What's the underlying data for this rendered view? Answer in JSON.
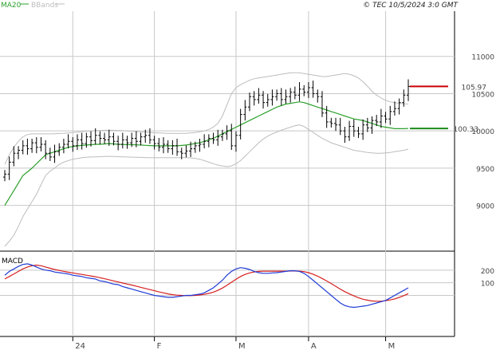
{
  "header": {
    "legend_ma": "MA20",
    "legend_bb": "BBands",
    "copyright": "© TEC 10/5/2024 3:0 GMT"
  },
  "colors": {
    "background": "#ffffff",
    "grid": "#c8c8c8",
    "price_bars": "#000000",
    "ma20": "#2ca02c",
    "bbands": "#bdbdbd",
    "last_price_marker": "#cc0000",
    "ma_marker": "#1a8c1a",
    "macd_line": "#1f3bd6",
    "signal_line": "#d62020",
    "axis_text": "#444444"
  },
  "chart_data": [
    {
      "type": "ohlc",
      "title": "",
      "x_labels": [
        "24",
        "F",
        "M",
        "A",
        "M"
      ],
      "y_ticks": [
        "11000",
        "10500",
        "10000",
        "9500",
        "9000"
      ],
      "ylim": [
        8450,
        11500
      ],
      "grid": true,
      "overlays": [
        "MA20",
        "BBands"
      ],
      "last_price_label": "105.97",
      "last_price": 10597,
      "ma20_label": "100.33",
      "ma20_last": 10033,
      "close": [
        9420,
        9580,
        9700,
        9740,
        9800,
        9760,
        9840,
        9780,
        9820,
        9700,
        9650,
        9720,
        9780,
        9820,
        9860,
        9800,
        9880,
        9830,
        9920,
        9870,
        9940,
        9900,
        9880,
        9920,
        9860,
        9820,
        9880,
        9840,
        9900,
        9860,
        9920,
        9940,
        9880,
        9830,
        9780,
        9820,
        9760,
        9800,
        9720,
        9700,
        9730,
        9760,
        9800,
        9820,
        9860,
        9900,
        9880,
        9920,
        9960,
        10000,
        9800,
        9940,
        10220,
        10320,
        10460,
        10420,
        10480,
        10380,
        10420,
        10460,
        10500,
        10420,
        10460,
        10520,
        10480,
        10560,
        10520,
        10580,
        10500,
        10460,
        10240,
        10120,
        10100,
        10080,
        10000,
        9920,
        10060,
        10000,
        9960,
        10080,
        10040,
        10140,
        10120,
        10200,
        10160,
        10260,
        10300,
        10380,
        10480,
        10597
      ],
      "ma20": [
        9000,
        9100,
        9200,
        9300,
        9400,
        9450,
        9500,
        9560,
        9620,
        9680,
        9700,
        9720,
        9740,
        9760,
        9780,
        9790,
        9800,
        9805,
        9810,
        9815,
        9820,
        9820,
        9825,
        9830,
        9825,
        9820,
        9818,
        9816,
        9814,
        9812,
        9810,
        9806,
        9803,
        9800,
        9800,
        9800,
        9800,
        9800,
        9800,
        9805,
        9810,
        9820,
        9830,
        9840,
        9860,
        9880,
        9900,
        9930,
        9960,
        9990,
        10020,
        10050,
        10080,
        10110,
        10140,
        10170,
        10200,
        10230,
        10260,
        10290,
        10320,
        10340,
        10360,
        10370,
        10380,
        10390,
        10380,
        10360,
        10340,
        10320,
        10300,
        10280,
        10260,
        10240,
        10220,
        10200,
        10180,
        10160,
        10150,
        10140,
        10120,
        10100,
        10080,
        10060,
        10050,
        10040,
        10030,
        10030,
        10030,
        10033
      ],
      "bb_upper": [
        9550,
        9680,
        9780,
        9860,
        9920,
        9950,
        9960,
        9960,
        9960,
        9960,
        9960,
        9962,
        9965,
        9968,
        9972,
        9978,
        9985,
        9990,
        9995,
        10000,
        10004,
        10006,
        10008,
        10010,
        10008,
        10006,
        10004,
        10000,
        9995,
        9990,
        9986,
        9982,
        9978,
        9975,
        9972,
        9970,
        9968,
        9966,
        9965,
        9966,
        9968,
        9972,
        9978,
        9988,
        10000,
        10020,
        10050,
        10100,
        10200,
        10350,
        10500,
        10580,
        10620,
        10650,
        10680,
        10700,
        10710,
        10720,
        10730,
        10740,
        10750,
        10760,
        10770,
        10780,
        10780,
        10780,
        10770,
        10760,
        10750,
        10740,
        10730,
        10730,
        10740,
        10750,
        10760,
        10770,
        10760,
        10740,
        10710,
        10660,
        10600,
        10530,
        10480,
        10440,
        10410,
        10390,
        10380,
        10370,
        10365,
        10360
      ],
      "bb_lower": [
        8450,
        8520,
        8600,
        8720,
        8850,
        8950,
        9050,
        9150,
        9280,
        9400,
        9460,
        9500,
        9550,
        9580,
        9600,
        9620,
        9630,
        9640,
        9645,
        9650,
        9652,
        9654,
        9656,
        9658,
        9656,
        9654,
        9652,
        9650,
        9648,
        9646,
        9644,
        9642,
        9640,
        9640,
        9640,
        9640,
        9640,
        9640,
        9640,
        9640,
        9640,
        9638,
        9630,
        9620,
        9600,
        9580,
        9560,
        9540,
        9530,
        9520,
        9530,
        9560,
        9600,
        9660,
        9720,
        9780,
        9840,
        9890,
        9930,
        9960,
        9985,
        10010,
        10030,
        10050,
        10070,
        10080,
        10060,
        10020,
        9980,
        9940,
        9900,
        9870,
        9840,
        9820,
        9800,
        9780,
        9760,
        9740,
        9730,
        9720,
        9710,
        9705,
        9700,
        9700,
        9705,
        9710,
        9720,
        9730,
        9740,
        9755
      ]
    },
    {
      "type": "line",
      "title": "MACD",
      "y_ticks": [
        "200",
        "100"
      ],
      "ylim": [
        -300,
        300
      ],
      "grid": true,
      "series": [
        {
          "name": "",
          "values": [
            160,
            190,
            210,
            230,
            245,
            250,
            240,
            225,
            210,
            200,
            195,
            185,
            180,
            175,
            170,
            160,
            155,
            150,
            140,
            135,
            130,
            115,
            110,
            100,
            90,
            85,
            70,
            60,
            50,
            40,
            30,
            20,
            10,
            0,
            -5,
            -10,
            -15,
            -15,
            -10,
            -5,
            0,
            0,
            5,
            10,
            20,
            40,
            60,
            90,
            120,
            160,
            190,
            210,
            220,
            215,
            205,
            190,
            180,
            175,
            175,
            178,
            180,
            185,
            190,
            195,
            195,
            190,
            175,
            150,
            120,
            90,
            60,
            30,
            0,
            -30,
            -60,
            -80,
            -90,
            -95,
            -90,
            -85,
            -80,
            -70,
            -60,
            -50,
            -40,
            -20,
            0,
            20,
            40,
            60
          ]
        },
        {
          "name": "",
          "values": [
            130,
            150,
            170,
            190,
            210,
            225,
            235,
            240,
            235,
            225,
            215,
            205,
            198,
            190,
            184,
            178,
            172,
            166,
            160,
            154,
            148,
            140,
            132,
            124,
            115,
            107,
            98,
            90,
            82,
            73,
            64,
            55,
            46,
            37,
            28,
            20,
            12,
            6,
            2,
            0,
            -2,
            -2,
            0,
            3,
            8,
            16,
            26,
            40,
            58,
            80,
            104,
            128,
            150,
            166,
            178,
            186,
            190,
            192,
            192,
            192,
            192,
            192,
            192,
            193,
            193,
            192,
            188,
            180,
            168,
            152,
            134,
            114,
            94,
            72,
            50,
            30,
            12,
            -4,
            -18,
            -30,
            -38,
            -44,
            -46,
            -46,
            -42,
            -36,
            -28,
            -16,
            -2,
            14
          ]
        }
      ]
    }
  ]
}
